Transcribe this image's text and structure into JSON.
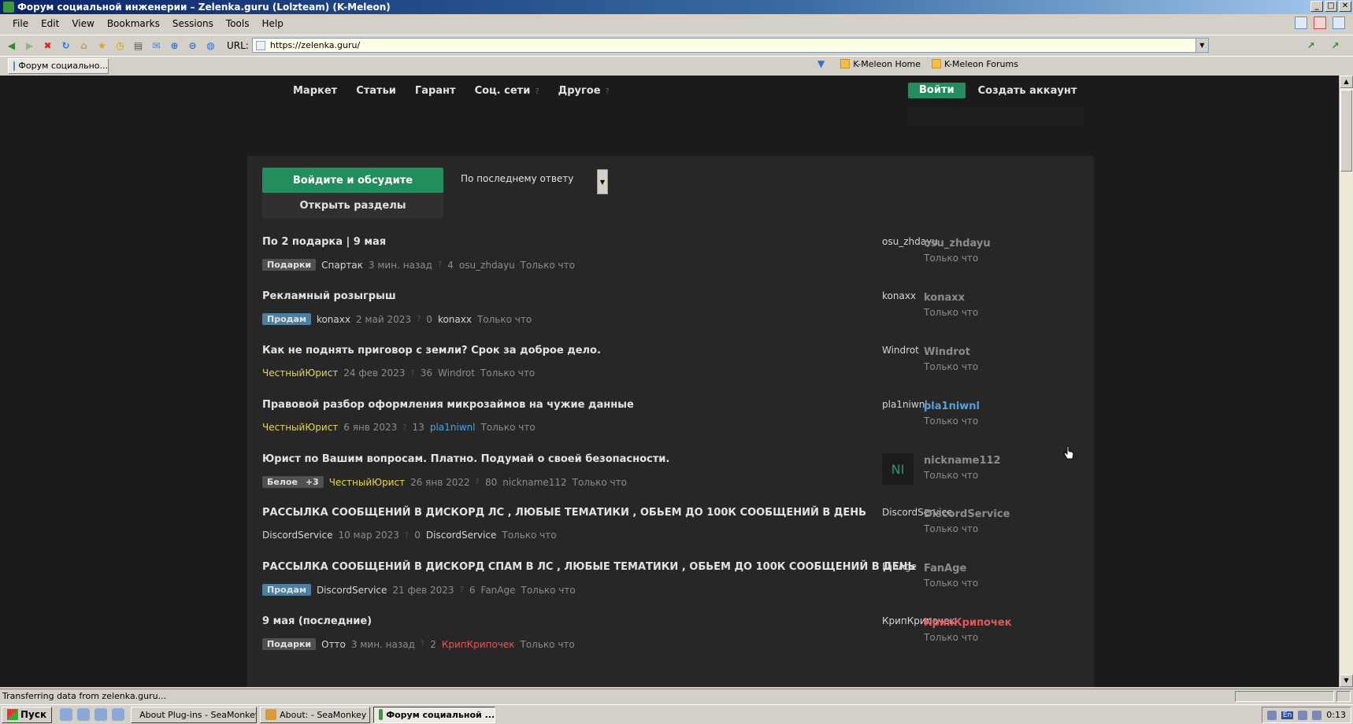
{
  "window": {
    "title": "Форум социальной инженерии – Zelenka.guru (Lolzteam) (K-Meleon)",
    "minimize": "_",
    "maximize": "□",
    "close": "✕"
  },
  "menu": [
    "File",
    "Edit",
    "View",
    "Bookmarks",
    "Sessions",
    "Tools",
    "Help"
  ],
  "toolbar": {
    "url_label": "URL:",
    "url": "https://zelenka.guru/"
  },
  "tab": {
    "label": "Форум социально..."
  },
  "bookmarks": [
    "K-Meleon Home",
    "K-Meleon Forums"
  ],
  "site": {
    "nav": [
      "Маркет",
      "Статьи",
      "Гарант",
      "Соц. сети",
      "Другое"
    ],
    "nav_q": "?",
    "login": "Войти",
    "signup": "Создать аккаунт",
    "discuss_button": "Войдите и обсудите",
    "open_sections_button": "Открыть разделы",
    "sort_label": "По последнему ответу"
  },
  "threads": [
    {
      "title": "По 2 подарка | 9 мая",
      "prefix": "Подарки",
      "author": "Спартак",
      "date": "3 мин. назад",
      "replies": "4",
      "last_author": "osu_zhdayu",
      "last_time": "Только что",
      "avatar_alt": "osu_zhdayu",
      "last_name": "osu_zhdayu",
      "last_when": "Только что"
    },
    {
      "title": "Рекламный розыгрыш",
      "prefix": "Продам",
      "author": "konaxx",
      "date": "2 май 2023",
      "replies": "0",
      "last_author": "konaxx",
      "last_time": "Только что",
      "avatar_alt": "konaxx",
      "last_name": "konaxx",
      "last_when": "Только что"
    },
    {
      "title": "Как не поднять приговор с земли? Срок за доброе дело.",
      "author": "ЧестныйЮрист",
      "date": "24 фев 2023",
      "replies": "36",
      "last_author": "Windrot",
      "last_time": "Только что",
      "avatar_alt": "Windrot",
      "last_name": "Windrot",
      "last_when": "Только что"
    },
    {
      "title": "Правовой разбор оформления микрозаймов на чужие данные",
      "author": "ЧестныйЮрист",
      "date": "6 янв 2023",
      "replies": "13",
      "last_author": "pla1niwnl",
      "last_time": "Только что",
      "avatar_alt": "pla1niwnl",
      "last_name": "pla1niwnl",
      "last_when": "Только что"
    },
    {
      "title": "Юрист по Вашим вопросам. Платно. Подумай о своей безопасности.",
      "prefix": "Белое",
      "prefix_extra": "+3",
      "author": "ЧестныйЮрист",
      "date": "26 янв 2022",
      "replies": "80",
      "last_author": "nickname112",
      "last_time": "Только что",
      "avatar_initials": "NI",
      "last_name": "nickname112",
      "last_when": "Только что"
    },
    {
      "title": "РАССЫЛКА СООБЩЕНИЙ В ДИСКОРД ЛС , ЛЮБЫЕ ТЕМАТИКИ , ОБЬЕМ ДО 100К СООБЩЕНИЙ В ДЕНЬ",
      "author": "DiscordService",
      "date": "10 мар 2023",
      "replies": "0",
      "last_author": "DiscordService",
      "last_time": "Только что",
      "avatar_alt": "DiscordService",
      "last_name": "DiscordService",
      "last_when": "Только что"
    },
    {
      "title": "РАССЫЛКА СООБЩЕНИЙ В ДИСКОРД СПАМ В ЛС , ЛЮБЫЕ ТЕМАТИКИ , ОБЬЕМ ДО 100К СООБЩЕНИЙ В ДЕНЬ",
      "prefix": "Продам",
      "author": "DiscordService",
      "date": "21 фев 2023",
      "replies": "6",
      "last_author": "FanAge",
      "last_time": "Только что",
      "avatar_alt": "FanAge",
      "last_name": "FanAge",
      "last_when": "Только что"
    },
    {
      "title": "9 мая (последние)",
      "prefix": "Подарки",
      "author": "Отто",
      "date": "3 мин. назад",
      "replies": "2",
      "last_author": "КрипКрипочек",
      "last_time": "Только что",
      "avatar_alt": "КрипКрипочек",
      "last_name": "КрипКрипочек",
      "last_when": "Только что"
    }
  ],
  "status": {
    "text": "Transferring data from zelenka.guru..."
  },
  "taskbar": {
    "start": "Пуск",
    "tasks": [
      "About Plug-ins - SeaMonkey",
      "About: - SeaMonkey",
      "Форум социальной ..."
    ],
    "lang": "En",
    "clock": "0:13"
  },
  "colors": {
    "accent_green": "#228e5d",
    "page_bg": "#1b1b1b",
    "content_bg": "#272727"
  }
}
